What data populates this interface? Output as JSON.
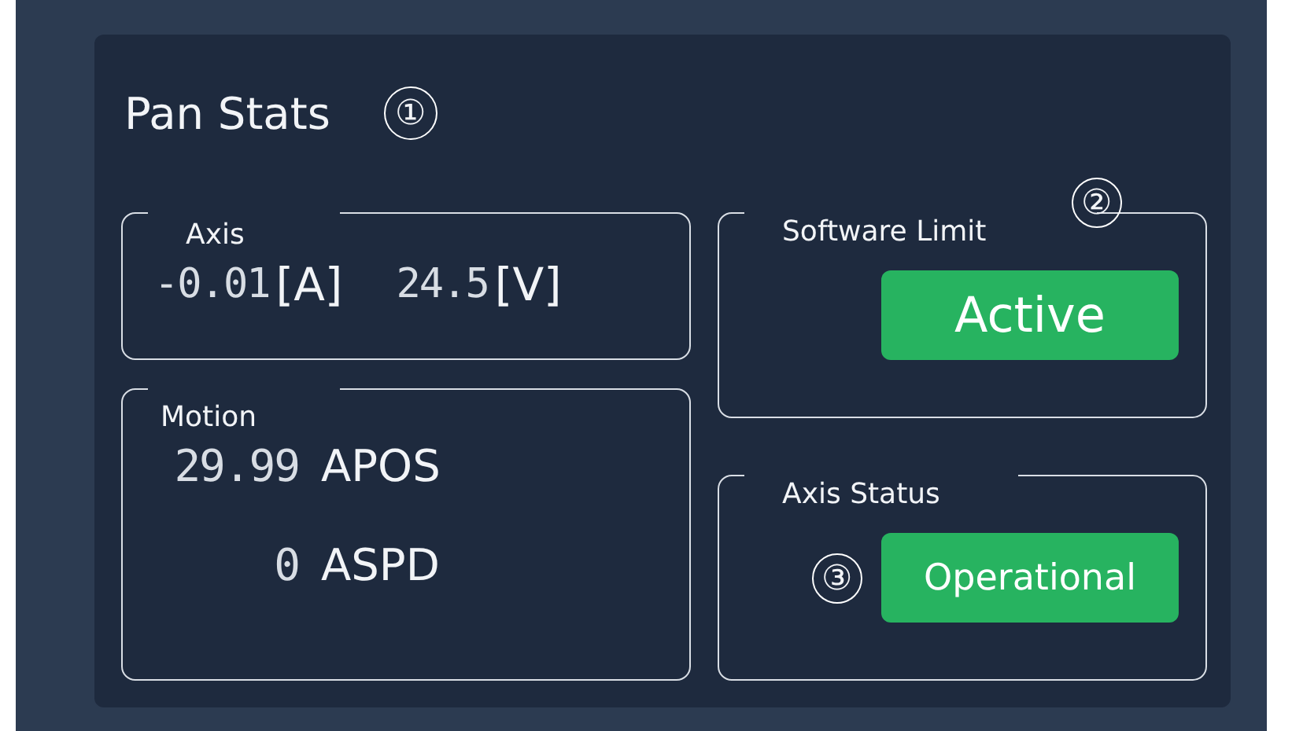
{
  "panel": {
    "title": "Pan Stats",
    "callout": "①"
  },
  "axis": {
    "label": "Axis",
    "readings": [
      {
        "value": "-0.01",
        "unit": "[A]"
      },
      {
        "value": "24.5",
        "unit": "[V]"
      }
    ]
  },
  "motion": {
    "label": "Motion",
    "rows": [
      {
        "value": "29.99",
        "name": "APOS"
      },
      {
        "value": "0",
        "name": "ASPD"
      }
    ]
  },
  "software_limit": {
    "label": "Software Limit",
    "callout": "②",
    "status": "Active"
  },
  "axis_status": {
    "label": "Axis Status",
    "callout": "③",
    "status": "Operational"
  }
}
